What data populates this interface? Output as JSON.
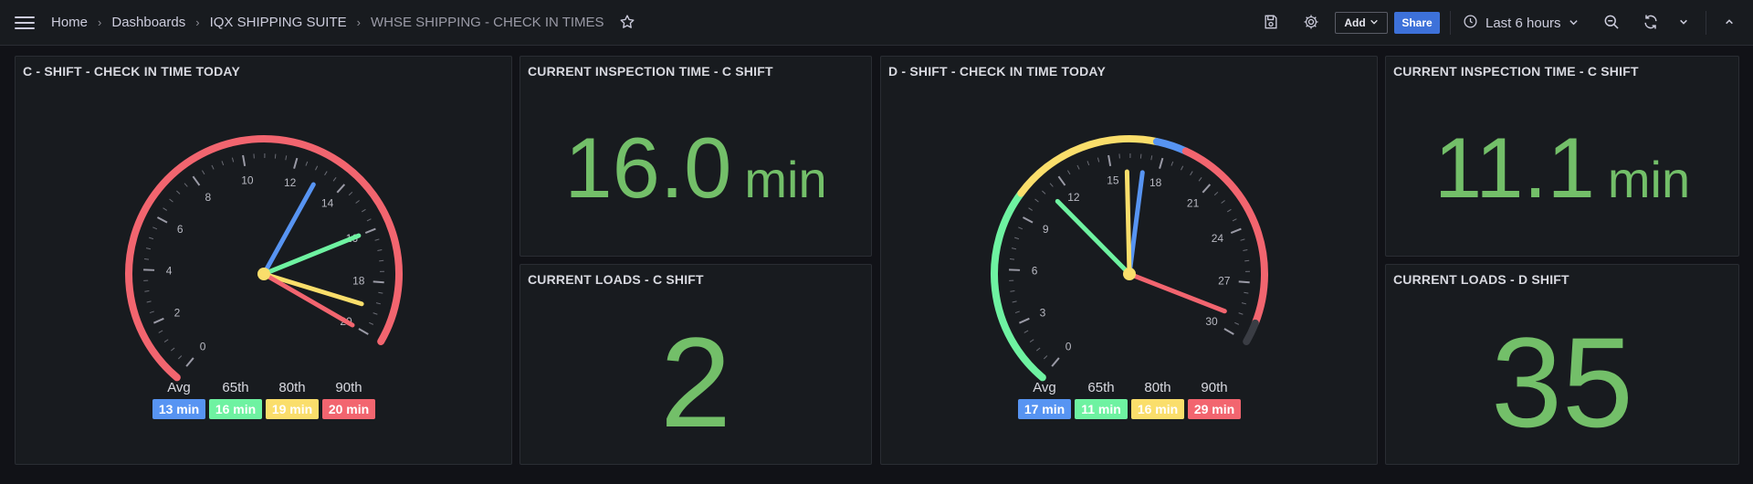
{
  "nav": {
    "breadcrumbs": [
      "Home",
      "Dashboards",
      "IQX SHIPPING SUITE"
    ],
    "current": "WHSE SHIPPING - CHECK IN TIMES"
  },
  "toolbar": {
    "add_label": "Add",
    "share_label": "Share",
    "time_range": "Last 6 hours",
    "icons": [
      "save-icon",
      "gear-icon",
      "clock-icon",
      "zoom-out-icon",
      "refresh-icon",
      "chevron-down-icon",
      "chevron-up-icon"
    ]
  },
  "colors": {
    "blue": "#5794f2",
    "green": "#73bf69",
    "light_green": "#6ef2a1",
    "yellow": "#fade6b",
    "red": "#f2656f"
  },
  "panels": {
    "gauge_c": {
      "title": "C - SHIFT - CHECK IN TIME TODAY",
      "min": 0,
      "max": 20,
      "major_ticks": [
        0,
        2,
        4,
        6,
        8,
        10,
        12,
        14,
        16,
        18,
        20
      ],
      "needles": [
        {
          "name": "Avg",
          "value": 13,
          "label": "13 min",
          "color": "#5794f2"
        },
        {
          "name": "65th",
          "value": 16,
          "label": "16 min",
          "color": "#6ef2a1"
        },
        {
          "name": "80th",
          "value": 19,
          "label": "19 min",
          "color": "#fade6b"
        },
        {
          "name": "90th",
          "value": 20,
          "label": "20 min",
          "color": "#f2656f"
        }
      ]
    },
    "stat_insp_c": {
      "title": "CURRENT INSPECTION TIME - C SHIFT",
      "value": "16.0",
      "unit": "min"
    },
    "stat_loads_c": {
      "title": "CURRENT LOADS - C SHIFT",
      "value": "2"
    },
    "gauge_d": {
      "title": "D - SHIFT - CHECK IN TIME TODAY",
      "min": 0,
      "max": 30,
      "major_ticks": [
        0,
        3,
        6,
        9,
        12,
        15,
        18,
        21,
        24,
        27,
        30
      ],
      "needles": [
        {
          "name": "Avg",
          "value": 17,
          "label": "17 min",
          "color": "#5794f2"
        },
        {
          "name": "65th",
          "value": 11,
          "label": "11 min",
          "color": "#6ef2a1"
        },
        {
          "name": "80th",
          "value": 16,
          "label": "16 min",
          "color": "#fade6b"
        },
        {
          "name": "90th",
          "value": 29,
          "label": "29 min",
          "color": "#f2656f"
        }
      ]
    },
    "stat_insp_d": {
      "title": "CURRENT INSPECTION TIME - C SHIFT",
      "value": "11.1",
      "unit": "min"
    },
    "stat_loads_d": {
      "title": "CURRENT LOADS - D SHIFT",
      "value": "35"
    }
  }
}
